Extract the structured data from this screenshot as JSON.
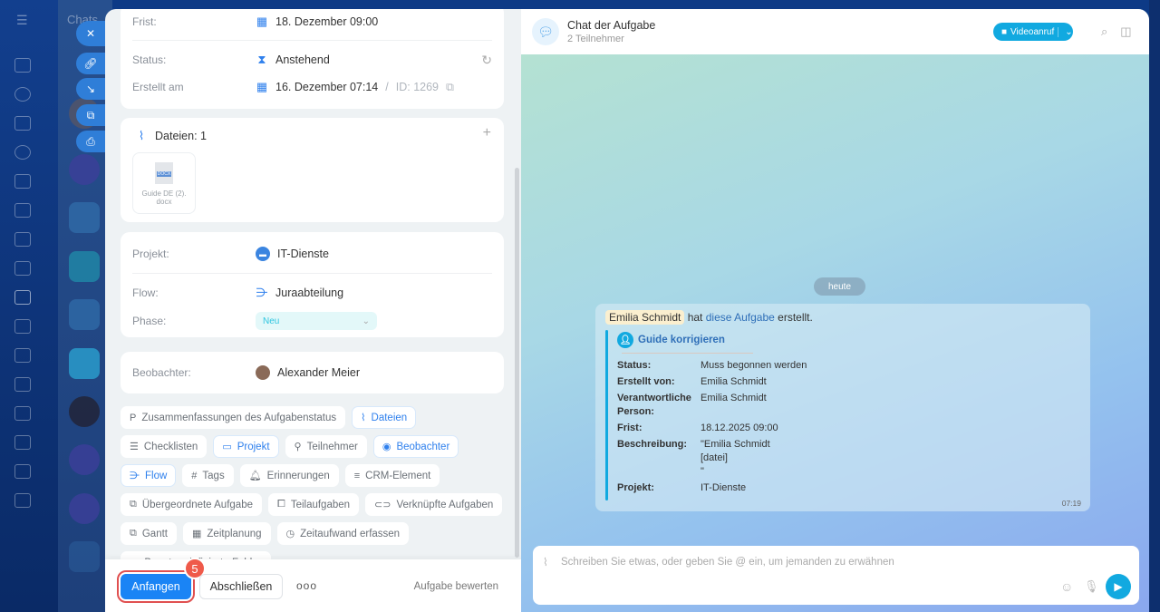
{
  "background": {
    "chats_label": "Chats"
  },
  "task": {
    "frist_label": "Frist:",
    "frist_value": "18. Dezember 09:00",
    "status_label": "Status:",
    "status_value": "Anstehend",
    "created_label": "Erstellt am",
    "created_value": "16. Dezember 07:14",
    "id_sep": "/",
    "id_value": "ID: 1269",
    "files_title": "Dateien: 1",
    "file_name": "Guide DE (2).",
    "file_ext": "docx",
    "file_badge": "DOCX",
    "projekt_label": "Projekt:",
    "projekt_value": "IT-Dienste",
    "flow_label": "Flow:",
    "flow_value": "Juraabteilung",
    "phase_label": "Phase:",
    "phase_value": "Neu",
    "observer_label": "Beobachter:",
    "observer_value": "Alexander Meier",
    "chips": [
      {
        "label": "Zusammenfassungen des Aufgabenstatus",
        "icon": "P",
        "active": false
      },
      {
        "label": "Dateien",
        "icon": "⌇",
        "active": true
      },
      {
        "label": "Checklisten",
        "icon": "☰",
        "active": false
      },
      {
        "label": "Projekt",
        "icon": "▭",
        "active": true
      },
      {
        "label": "Teilnehmer",
        "icon": "⚲",
        "active": false
      },
      {
        "label": "Beobachter",
        "icon": "◉",
        "active": true
      },
      {
        "label": "Flow",
        "icon": "⋺",
        "active": true
      },
      {
        "label": "Tags",
        "icon": "#",
        "active": false
      },
      {
        "label": "Erinnerungen",
        "icon": "🔔︎",
        "active": false
      },
      {
        "label": "CRM-Element",
        "icon": "≡",
        "active": false
      },
      {
        "label": "Übergeordnete Aufgabe",
        "icon": "⧉",
        "active": false
      },
      {
        "label": "Teilaufgaben",
        "icon": "⧠",
        "active": false
      },
      {
        "label": "Verknüpfte Aufgaben",
        "icon": "⊂⊃",
        "active": false
      },
      {
        "label": "Gantt",
        "icon": "⧉",
        "active": false
      },
      {
        "label": "Zeitplanung",
        "icon": "▦",
        "active": false
      },
      {
        "label": "Zeitaufwand erfassen",
        "icon": "◷",
        "active": false
      },
      {
        "label": "Benutzerdefinierte Felder",
        "icon": "▭",
        "active": false
      }
    ],
    "start_button": "Anfangen",
    "step_badge": "5",
    "complete_button": "Abschließen",
    "more_button": "ooo",
    "rate_link": "Aufgabe bewerten"
  },
  "chat": {
    "title": "Chat der Aufgabe",
    "subtitle": "2 Teilnehmer",
    "video_button": "Videoanruf",
    "date_divider": "heute",
    "message": {
      "author": "Emilia Schmidt",
      "text_mid": "hat",
      "link": "diese Aufgabe",
      "text_end": "erstellt.",
      "quote_title": "Guide korrigieren",
      "fields": [
        {
          "key": "Status:",
          "value": "Muss begonnen werden"
        },
        {
          "key": "Erstellt von:",
          "value": "Emilia Schmidt"
        },
        {
          "key": "Verantwortliche Person:",
          "value": "Emilia Schmidt"
        },
        {
          "key": "Frist:",
          "value": "18.12.2025 09:00"
        },
        {
          "key": "Beschreibung:",
          "value": "\"Emilia Schmidt\n[datei]\n\""
        },
        {
          "key": "Projekt:",
          "value": "IT-Dienste"
        }
      ],
      "time": "07:19"
    },
    "input_placeholder": "Schreiben Sie etwas, oder geben Sie @ ein, um jemanden zu erwähnen"
  }
}
